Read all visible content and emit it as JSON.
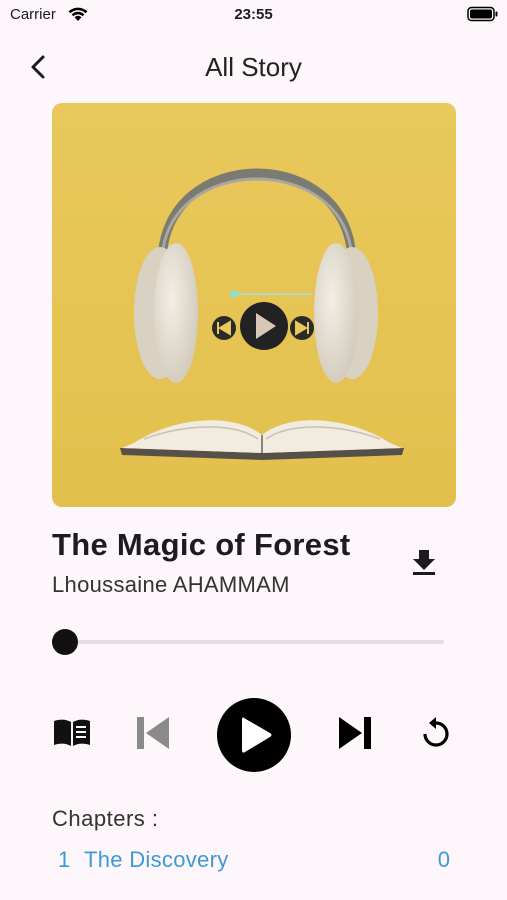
{
  "status_bar": {
    "carrier": "Carrier",
    "time": "23:55"
  },
  "app_bar": {
    "title": "All Story",
    "back_icon": "chevron-left-icon"
  },
  "cover": {
    "description_icon": "headphones-book-artwork"
  },
  "track": {
    "title": "The Magic of Forest",
    "author": "Lhoussaine AHAMMAM",
    "download_icon": "download-icon",
    "progress": 0.0
  },
  "controls": {
    "book_icon": "book-icon",
    "previous_icon": "skip-previous-icon",
    "play_icon": "play-icon",
    "next_icon": "skip-next-icon",
    "replay_icon": "replay-icon",
    "previous_enabled": false
  },
  "chapters": {
    "label": "Chapters :",
    "items": [
      {
        "number": "1",
        "name": "The Discovery",
        "count": "0"
      }
    ]
  },
  "colors": {
    "background": "#fdf6fb",
    "accent_link": "#3d9ad6",
    "cover_yellow": "#e6c454",
    "disabled": "#8a8a8a"
  }
}
